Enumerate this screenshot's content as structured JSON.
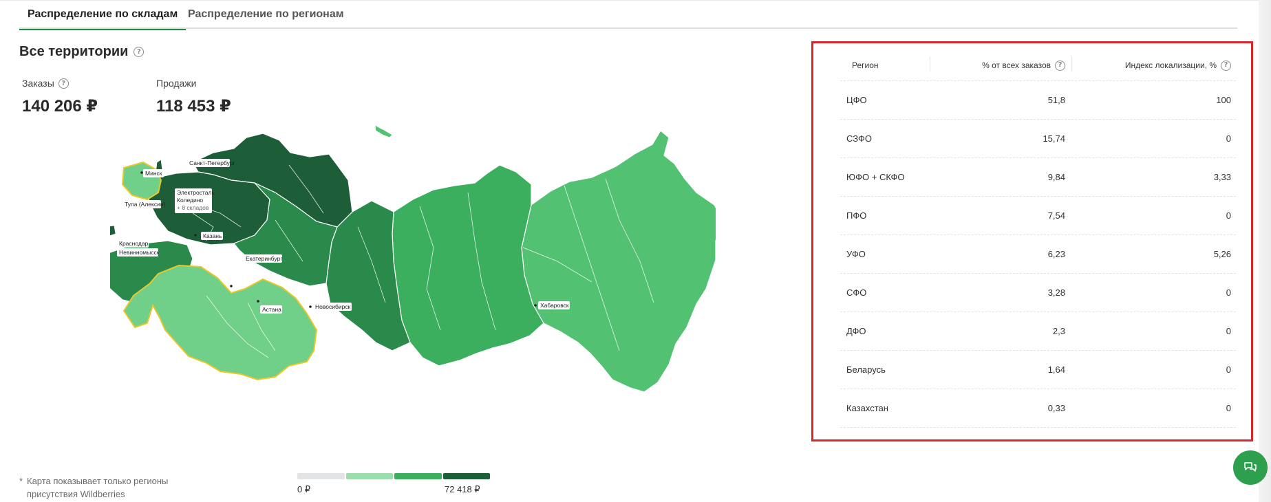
{
  "tabs": [
    {
      "label": "Распределение по складам",
      "active": true
    },
    {
      "label": "Распределение по регионам",
      "active": false
    }
  ],
  "title": "Все территории",
  "kpis": {
    "orders": {
      "label": "Заказы",
      "value": "140 206 ₽"
    },
    "sales": {
      "label": "Продажи",
      "value": "118 453 ₽"
    }
  },
  "map": {
    "warehouse_labels": [
      "Санкт-Петербург",
      "Минск",
      "Электросталь",
      "Коледино",
      "+ 8 складов",
      "Тула (Алексин)",
      "Казань",
      "Краснодар",
      "Невинномысск",
      "Екатеринбург",
      "Новосибирск",
      "Астана",
      "Хабаровск"
    ],
    "colors": {
      "darkest": "#1d5e38",
      "dark": "#2a8a4c",
      "medium": "#3caf5f",
      "light": "#52c172",
      "lightest": "#70cf88",
      "border_highlight": "#e8c82a"
    }
  },
  "footnote": {
    "star": "*",
    "text": "Карта показывает только регионы присутствия Wildberries"
  },
  "legend": {
    "min": "0 ₽",
    "max": "72 418 ₽",
    "colors": [
      "#e3e4e6",
      "#9bdcad",
      "#3caf5f",
      "#1d5e38"
    ]
  },
  "table": {
    "headers": {
      "region": "Регион",
      "pct": "% от всех заказов",
      "index": "Индекс локализации, %"
    },
    "rows": [
      {
        "region": "ЦФО",
        "pct": "51,8",
        "index": "100"
      },
      {
        "region": "СЗФО",
        "pct": "15,74",
        "index": "0"
      },
      {
        "region": "ЮФО + СКФО",
        "pct": "9,84",
        "index": "3,33"
      },
      {
        "region": "ПФО",
        "pct": "7,54",
        "index": "0"
      },
      {
        "region": "УФО",
        "pct": "6,23",
        "index": "5,26"
      },
      {
        "region": "СФО",
        "pct": "3,28",
        "index": "0"
      },
      {
        "region": "ДФО",
        "pct": "2,3",
        "index": "0"
      },
      {
        "region": "Беларусь",
        "pct": "1,64",
        "index": "0"
      },
      {
        "region": "Казахстан",
        "pct": "0,33",
        "index": "0"
      }
    ]
  },
  "icons": {
    "help": "question-circle-icon",
    "chat": "chat-bubbles-icon"
  }
}
